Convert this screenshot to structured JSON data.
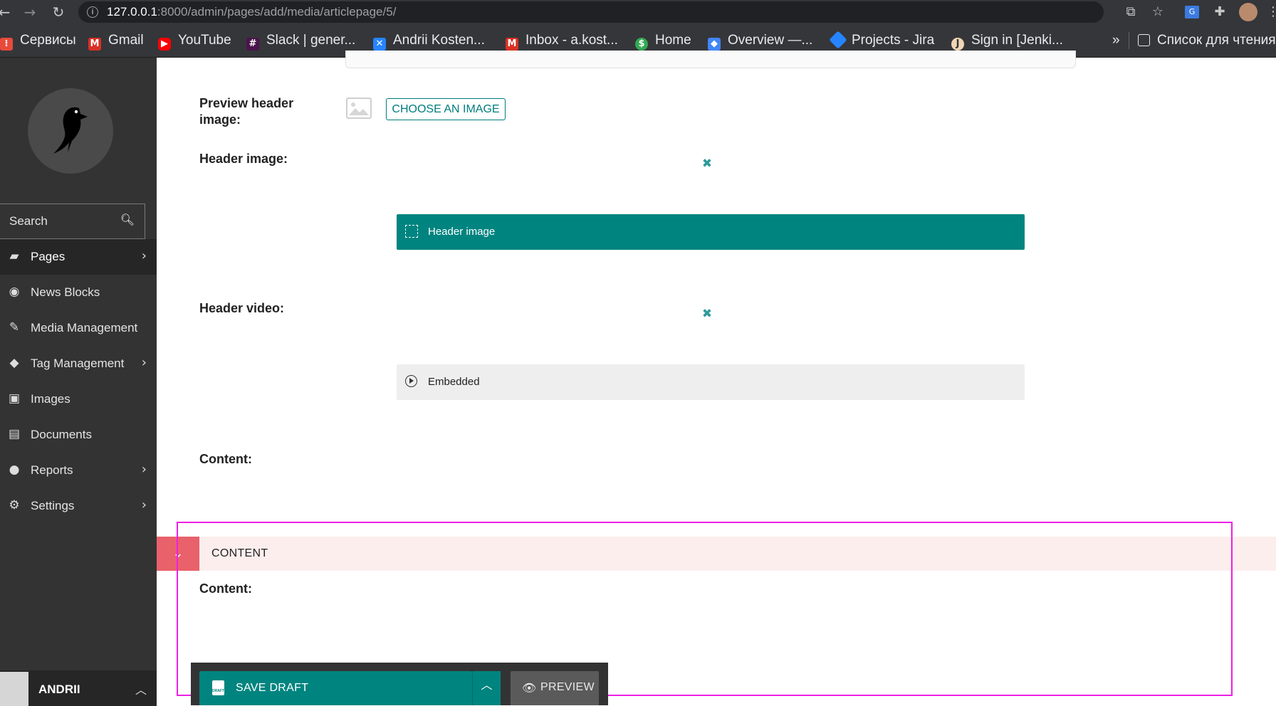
{
  "browser": {
    "url_host": "127.0.0.1",
    "url_path": ":8000/admin/pages/add/media/articlepage/5/",
    "bookmarks": [
      {
        "label": "Сервисы",
        "icon": "apps-grid-icon",
        "color": "#ea4335"
      },
      {
        "label": "Gmail",
        "icon": "gmail-icon",
        "color": "#d93025"
      },
      {
        "label": "YouTube",
        "icon": "youtube-icon",
        "color": "#ff0000"
      },
      {
        "label": "Slack | gener...",
        "icon": "slack-icon",
        "color": "#e01e5a"
      },
      {
        "label": "Andrii Kosten...",
        "icon": "confluence-icon",
        "color": "#2684ff"
      },
      {
        "label": "Inbox - a.kost...",
        "icon": "gmail-icon",
        "color": "#d93025"
      },
      {
        "label": "Home",
        "icon": "home-favicon-icon",
        "color": "#34a853"
      },
      {
        "label": "Overview —...",
        "icon": "shield-favicon-icon",
        "color": "#4285f4"
      },
      {
        "label": "Projects - Jira",
        "icon": "jira-icon",
        "color": "#2684ff"
      },
      {
        "label": "Sign in [Jenki...",
        "icon": "jenkins-icon",
        "color": "#d33833"
      }
    ],
    "bookmarks_overflow": "»",
    "reading_list": "Список для чтения"
  },
  "sidebar": {
    "search_label": "Search",
    "items": [
      {
        "label": "Pages",
        "icon": "folder-open-icon",
        "has_arrow": true,
        "active": true
      },
      {
        "label": "News Blocks",
        "icon": "play-circle-icon",
        "has_arrow": false
      },
      {
        "label": "Media Management",
        "icon": "pencil-icon",
        "has_arrow": false
      },
      {
        "label": "Tag Management",
        "icon": "tag-icon",
        "has_arrow": true
      },
      {
        "label": "Images",
        "icon": "image-icon",
        "has_arrow": false
      },
      {
        "label": "Documents",
        "icon": "document-icon",
        "has_arrow": false
      },
      {
        "label": "Reports",
        "icon": "globe-icon",
        "has_arrow": true
      },
      {
        "label": "Settings",
        "icon": "cogs-icon",
        "has_arrow": true
      }
    ],
    "user_name": "ANDRII"
  },
  "form": {
    "preview_header_image_label": "Preview header image:",
    "choose_image_label": "CHOOSE AN IMAGE",
    "header_image_label": "Header image:",
    "header_image_block": "Header image",
    "header_video_label": "Header video:",
    "embedded_block": "Embedded",
    "content_label_1": "Content:",
    "content_block_title": "CONTENT",
    "content_label_2": "Content:"
  },
  "footer": {
    "save_draft_label": "SAVE DRAFT",
    "preview_label": "PREVIEW"
  },
  "colors": {
    "teal": "#00847f",
    "highlight": "#ee1fe6",
    "collapse_red": "#e9616b",
    "sidebar_bg": "#333333"
  }
}
